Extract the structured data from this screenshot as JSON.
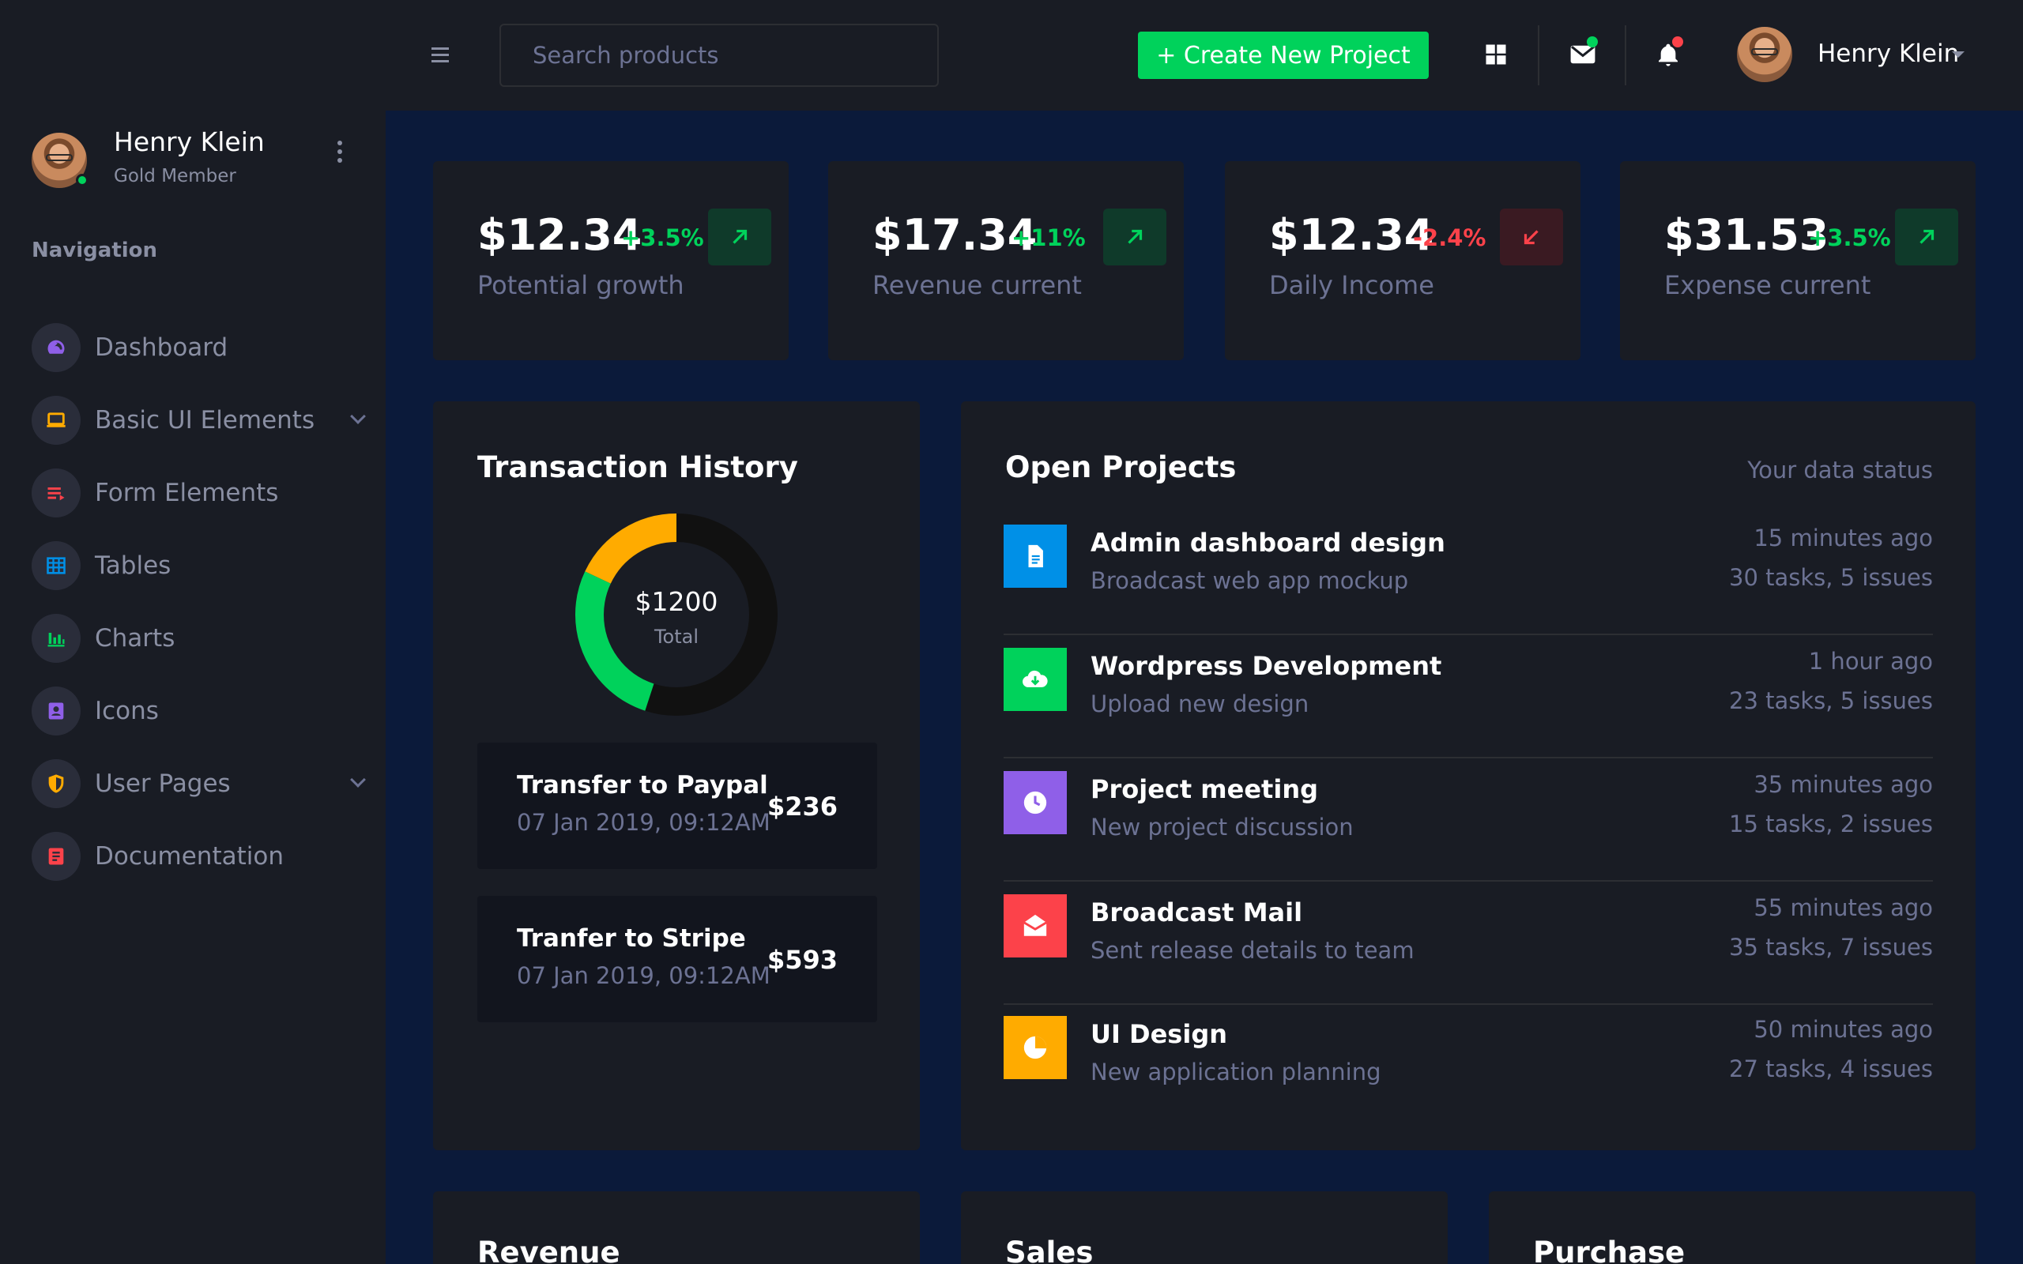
{
  "colors": {
    "accent_green": "#00d25b",
    "accent_red": "#fc424a",
    "accent_orange": "#ffab00",
    "accent_purple": "#8f5fe8",
    "accent_blue": "#0090e7",
    "muted_text": "#6c7293",
    "panel_bg": "#191c24",
    "page_bg": "#0b1a3a"
  },
  "sidebar": {
    "profile": {
      "name": "Henry Klein",
      "role": "Gold Member"
    },
    "heading": "Navigation",
    "items": [
      {
        "label": "Dashboard",
        "icon": "speedometer-icon",
        "color": "#8f5fe8",
        "expandable": false
      },
      {
        "label": "Basic UI Elements",
        "icon": "laptop-icon",
        "color": "#ffab00",
        "expandable": true
      },
      {
        "label": "Form Elements",
        "icon": "playlist-icon",
        "color": "#fc424a",
        "expandable": false
      },
      {
        "label": "Tables",
        "icon": "table-icon",
        "color": "#0090e7",
        "expandable": false
      },
      {
        "label": "Charts",
        "icon": "bar-chart-icon",
        "color": "#00d25b",
        "expandable": false
      },
      {
        "label": "Icons",
        "icon": "contacts-icon",
        "color": "#8f5fe8",
        "expandable": false
      },
      {
        "label": "User Pages",
        "icon": "shield-icon",
        "color": "#ffab00",
        "expandable": true
      },
      {
        "label": "Documentation",
        "icon": "document-icon",
        "color": "#fc424a",
        "expandable": false
      }
    ]
  },
  "topbar": {
    "search_placeholder": "Search products",
    "create_button": "+ Create New Project",
    "user_name": "Henry Klein"
  },
  "stats": [
    {
      "value": "$12.34",
      "change": "+3.5%",
      "label": "Potential growth",
      "trend": "up"
    },
    {
      "value": "$17.34",
      "change": "+11%",
      "label": "Revenue current",
      "trend": "up"
    },
    {
      "value": "$12.34",
      "change": "-2.4%",
      "label": "Daily Income",
      "trend": "down"
    },
    {
      "value": "$31.53",
      "change": "+3.5%",
      "label": "Expense current",
      "trend": "up"
    }
  ],
  "transactions": {
    "title": "Transaction History",
    "chart_data": {
      "type": "pie",
      "center_value": "$1200",
      "center_label": "Total",
      "slices": [
        {
          "color": "#111111",
          "value": 0.55
        },
        {
          "color": "#00d25b",
          "value": 0.27
        },
        {
          "color": "#ffab00",
          "value": 0.18
        }
      ]
    },
    "items": [
      {
        "title": "Transfer to Paypal",
        "date": "07 Jan 2019, 09:12AM",
        "amount": "$236"
      },
      {
        "title": "Tranfer to Stripe",
        "date": "07 Jan 2019, 09:12AM",
        "amount": "$593"
      }
    ]
  },
  "projects": {
    "title": "Open Projects",
    "status_link": "Your data status",
    "items": [
      {
        "title": "Admin dashboard design",
        "subtitle": "Broadcast web app mockup",
        "time": "15 minutes ago",
        "tasks": "30 tasks, 5 issues",
        "icon": "file-icon",
        "color": "#0090e7"
      },
      {
        "title": "Wordpress Development",
        "subtitle": "Upload new design",
        "time": "1 hour ago",
        "tasks": "23 tasks, 5 issues",
        "icon": "cloud-download-icon",
        "color": "#00d25b"
      },
      {
        "title": "Project meeting",
        "subtitle": "New project discussion",
        "time": "35 minutes ago",
        "tasks": "15 tasks, 2 issues",
        "icon": "clock-icon",
        "color": "#8f5fe8"
      },
      {
        "title": "Broadcast Mail",
        "subtitle": "Sent release details to team",
        "time": "55 minutes ago",
        "tasks": "35 tasks, 7 issues",
        "icon": "email-open-icon",
        "color": "#fc424a"
      },
      {
        "title": "UI Design",
        "subtitle": "New application planning",
        "time": "50 minutes ago",
        "tasks": "27 tasks, 4 issues",
        "icon": "pie-chart-icon",
        "color": "#ffab00"
      }
    ]
  },
  "bottom_panels": {
    "revenue": "Revenue",
    "sales": "Sales",
    "purchase": "Purchase"
  }
}
